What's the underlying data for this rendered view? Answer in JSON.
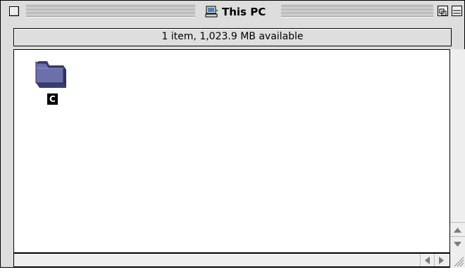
{
  "window": {
    "title": "This PC",
    "title_icon": "computer-icon"
  },
  "header": {
    "info": "1 item, 1,023.9 MB available"
  },
  "items": [
    {
      "label": "C",
      "icon": "folder-icon",
      "selected": true
    }
  ],
  "controls": {
    "close": "close-box",
    "zoom": "zoom-box",
    "collapse": "collapse-box",
    "scroll_up": "up-arrow-icon",
    "scroll_down": "down-arrow-icon",
    "scroll_left": "left-arrow-icon",
    "scroll_right": "right-arrow-icon",
    "resize": "grow-box"
  },
  "colors": {
    "chrome": "#dddddd",
    "content": "#ffffff",
    "selection": "#000000",
    "folder": "#5a5f9a"
  }
}
